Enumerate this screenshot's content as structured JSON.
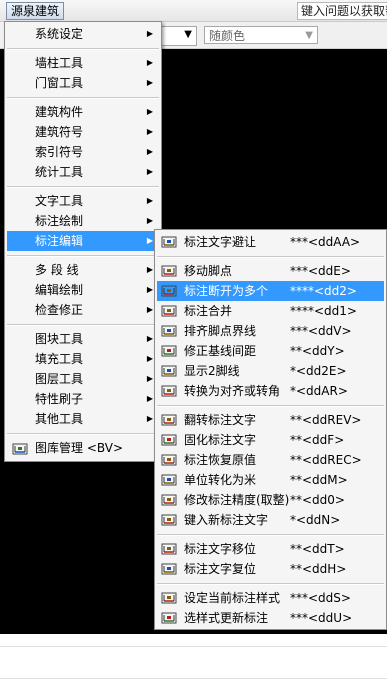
{
  "menubar": {
    "title": "源泉建筑",
    "help_placeholder": "键入问题以获取帮助"
  },
  "toolbar": {
    "color_select": "随颜色"
  },
  "main_menu": {
    "items": [
      {
        "label": "系统设定",
        "has_sub": true
      },
      {
        "sep": true
      },
      {
        "label": "墙柱工具",
        "has_sub": true
      },
      {
        "label": "门窗工具",
        "has_sub": true
      },
      {
        "sep": true
      },
      {
        "label": "建筑构件",
        "has_sub": true
      },
      {
        "label": "建筑符号",
        "has_sub": true
      },
      {
        "label": "索引符号",
        "has_sub": true
      },
      {
        "label": "统计工具",
        "has_sub": true
      },
      {
        "sep": true
      },
      {
        "label": "文字工具",
        "has_sub": true
      },
      {
        "label": "标注绘制",
        "has_sub": true
      },
      {
        "label": "标注编辑",
        "has_sub": true,
        "highlighted": true
      },
      {
        "sep": true
      },
      {
        "label": "多 段 线",
        "has_sub": true
      },
      {
        "label": "编辑绘制",
        "has_sub": true
      },
      {
        "label": "检查修正",
        "has_sub": true
      },
      {
        "sep": true
      },
      {
        "label": "图块工具",
        "has_sub": true
      },
      {
        "label": "填充工具",
        "has_sub": true
      },
      {
        "label": "图层工具",
        "has_sub": true
      },
      {
        "label": "特性刷子",
        "has_sub": true
      },
      {
        "label": "其他工具",
        "has_sub": true
      },
      {
        "sep": true
      },
      {
        "label": "图库管理 <BV>",
        "icon": "library-icon"
      }
    ]
  },
  "sub_menu": {
    "items": [
      {
        "label": "标注文字避让",
        "shortcut": "***<ddAA>",
        "icon": "dim-text-avoid-icon"
      },
      {
        "sep": true
      },
      {
        "label": "移动脚点",
        "shortcut": "***<ddE>",
        "icon": "move-foot-icon"
      },
      {
        "label": "标注断开为多个",
        "shortcut": "****<dd2>",
        "icon": "dim-break-icon",
        "highlighted": true
      },
      {
        "label": "标注合并",
        "shortcut": "****<dd1>",
        "icon": "dim-merge-icon"
      },
      {
        "label": "排齐脚点界线",
        "shortcut": "***<ddV>",
        "icon": "align-foot-icon"
      },
      {
        "label": "修正基线间距",
        "shortcut": "**<ddY>",
        "icon": "fix-baseline-icon"
      },
      {
        "label": "显示2脚线",
        "shortcut": "*<dd2E>",
        "icon": "show-2foot-icon"
      },
      {
        "label": "转换为对齐或转角",
        "shortcut": "*<ddAR>",
        "icon": "convert-align-icon"
      },
      {
        "sep": true
      },
      {
        "label": "翻转标注文字",
        "shortcut": "**<ddREV>",
        "icon": "flip-text-icon"
      },
      {
        "label": "固化标注文字",
        "shortcut": "**<ddF>",
        "icon": "fix-text-icon"
      },
      {
        "label": "标注恢复原值",
        "shortcut": "**<ddREC>",
        "icon": "restore-value-icon"
      },
      {
        "label": "单位转化为米",
        "shortcut": "**<ddM>",
        "icon": "unit-meter-icon"
      },
      {
        "label": "修改标注精度(取整)",
        "shortcut": "**<dd0>",
        "icon": "precision-icon"
      },
      {
        "label": "键入新标注文字",
        "shortcut": "*<ddN>",
        "icon": "type-text-icon"
      },
      {
        "sep": true
      },
      {
        "label": "标注文字移位",
        "shortcut": "**<ddT>",
        "icon": "text-move-icon"
      },
      {
        "label": "标注文字复位",
        "shortcut": "**<ddH>",
        "icon": "text-reset-icon"
      },
      {
        "sep": true
      },
      {
        "label": "设定当前标注样式",
        "shortcut": "***<ddS>",
        "icon": "set-style-icon"
      },
      {
        "label": "选样式更新标注",
        "shortcut": "***<ddU>",
        "icon": "update-style-icon"
      }
    ]
  }
}
